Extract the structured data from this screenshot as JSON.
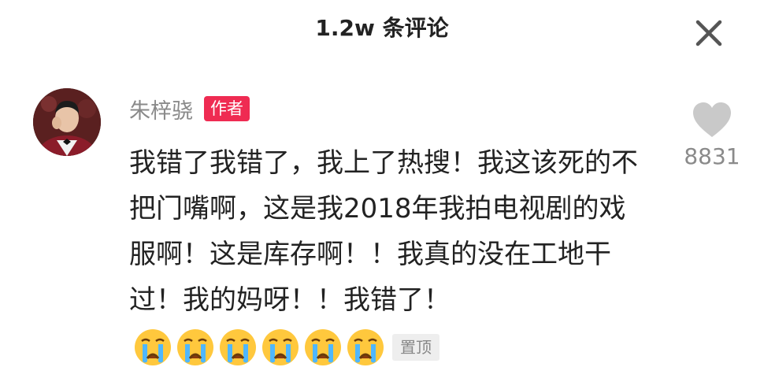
{
  "header": {
    "title": "1.2w 条评论"
  },
  "comment": {
    "author": "朱梓骁",
    "author_badge": "作者",
    "text": "我错了我错了，我上了热搜！我这该死的不把门嘴啊，这是我2018年我拍电视剧的戏服啊！这是库存啊！！我真的没在工地干过！我的妈呀！！我错了！",
    "emojis": [
      "crying-emoji",
      "crying-emoji",
      "crying-emoji",
      "crying-emoji",
      "crying-emoji",
      "crying-emoji"
    ],
    "pin_label": "置顶",
    "like_count": "8831"
  },
  "colors": {
    "badge_red": "#ef2b52",
    "muted_text": "#8a8a8a",
    "main_text": "#222222",
    "like_gray": "#c9c9c9"
  }
}
